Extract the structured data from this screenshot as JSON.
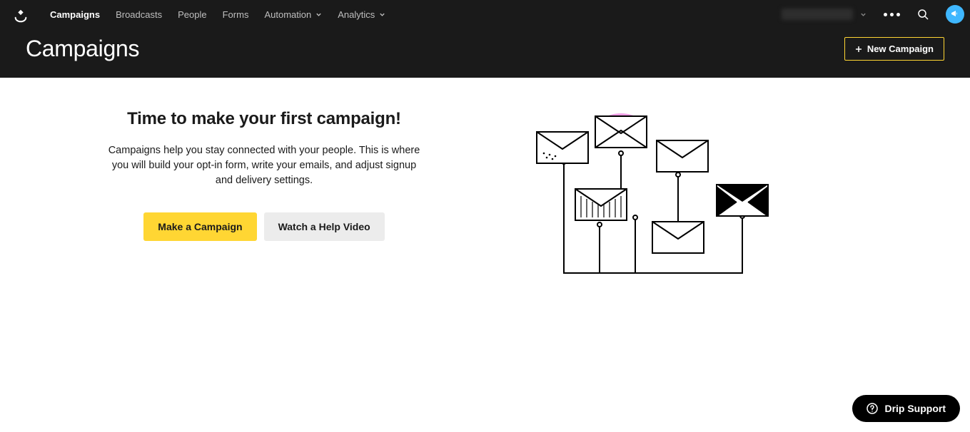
{
  "nav": {
    "items": [
      {
        "label": "Campaigns",
        "active": true
      },
      {
        "label": "Broadcasts"
      },
      {
        "label": "People"
      },
      {
        "label": "Forms"
      },
      {
        "label": "Automation",
        "dropdown": true
      },
      {
        "label": "Analytics",
        "dropdown": true
      }
    ]
  },
  "header": {
    "page_title": "Campaigns",
    "new_campaign_label": "New Campaign"
  },
  "empty_state": {
    "title": "Time to make your first campaign!",
    "description": "Campaigns help you stay connected with your people. This is where you will build your opt-in form, write your emails, and adjust signup and delivery settings.",
    "primary_button": "Make a Campaign",
    "secondary_button": "Watch a Help Video"
  },
  "support": {
    "label": "Drip Support"
  }
}
